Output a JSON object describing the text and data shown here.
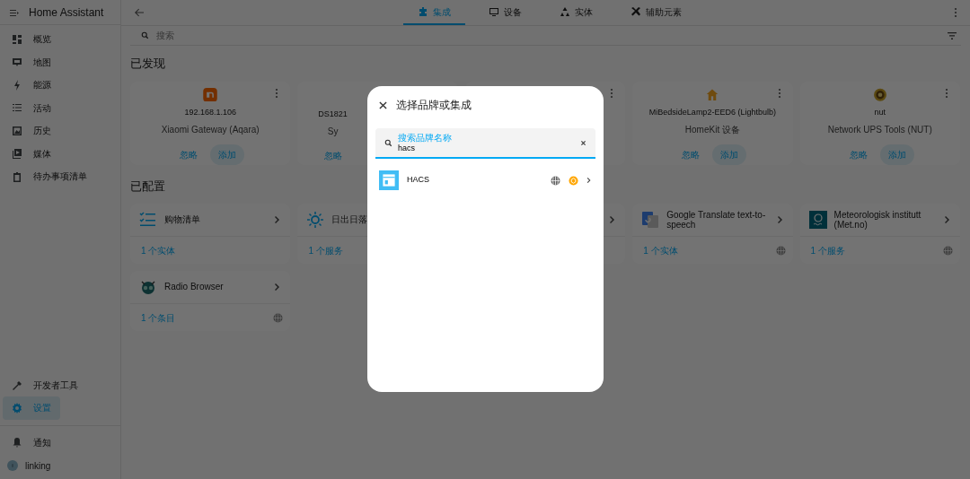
{
  "sidebar": {
    "title": "Home Assistant",
    "items": [
      {
        "label": "概览",
        "selected": false
      },
      {
        "label": "地图",
        "selected": false
      },
      {
        "label": "能源",
        "selected": false
      },
      {
        "label": "活动",
        "selected": false
      },
      {
        "label": "历史",
        "selected": false
      },
      {
        "label": "媒体",
        "selected": false
      },
      {
        "label": "待办事项清单",
        "selected": false
      }
    ],
    "bottom_items": [
      {
        "label": "开发者工具",
        "selected": false
      },
      {
        "label": "设置",
        "selected": true
      }
    ],
    "notifications": "通知",
    "user": {
      "name": "linking"
    }
  },
  "tabs": [
    {
      "label": "集成",
      "selected": true
    },
    {
      "label": "设备",
      "selected": false
    },
    {
      "label": "实体",
      "selected": false
    },
    {
      "label": "辅助元素",
      "selected": false
    }
  ],
  "search": {
    "placeholder": "搜索"
  },
  "discovered": {
    "heading": "已发现",
    "cards": [
      {
        "kind": "full",
        "title": "192.168.1.106",
        "subtitle": "Xiaomi Gateway (Aqara)",
        "ignore": "忽略",
        "add": "添加"
      },
      {
        "kind": "partial",
        "title": "DS1821",
        "subtitle": "Sy",
        "ignore": "忽略"
      },
      {
        "kind": "covered"
      },
      {
        "kind": "full",
        "title": "MiBedsideLamp2-EED6 (Lightbulb)",
        "subtitle": "HomeKit 设备",
        "ignore": "忽略",
        "add": "添加"
      },
      {
        "kind": "full",
        "title": "nut",
        "subtitle": "Network UPS Tools (NUT)",
        "ignore": "忽略",
        "add": "添加"
      }
    ]
  },
  "configured": {
    "heading": "已配置",
    "cards": [
      {
        "kind": "full",
        "title": "购物清单",
        "count": "1 个实体",
        "cloud": false
      },
      {
        "kind": "partial",
        "title": "日出日落",
        "count": "1 个服务",
        "cloud": false
      },
      {
        "kind": "covered"
      },
      {
        "kind": "full",
        "title": "Google Translate text-to-speech",
        "count": "1 个实体",
        "cloud": true
      },
      {
        "kind": "full",
        "title": "Meteorologisk institutt (Met.no)",
        "count": "1 个服务",
        "cloud": true
      },
      {
        "kind": "full",
        "title": "Radio Browser",
        "count": "1 个条目",
        "cloud": true
      }
    ]
  },
  "dialog": {
    "title": "选择品牌或集成",
    "search": {
      "label": "搜索品牌名称",
      "value": "hacs"
    },
    "results": [
      {
        "name": "HACS",
        "cloud": true,
        "custom": true
      }
    ]
  }
}
